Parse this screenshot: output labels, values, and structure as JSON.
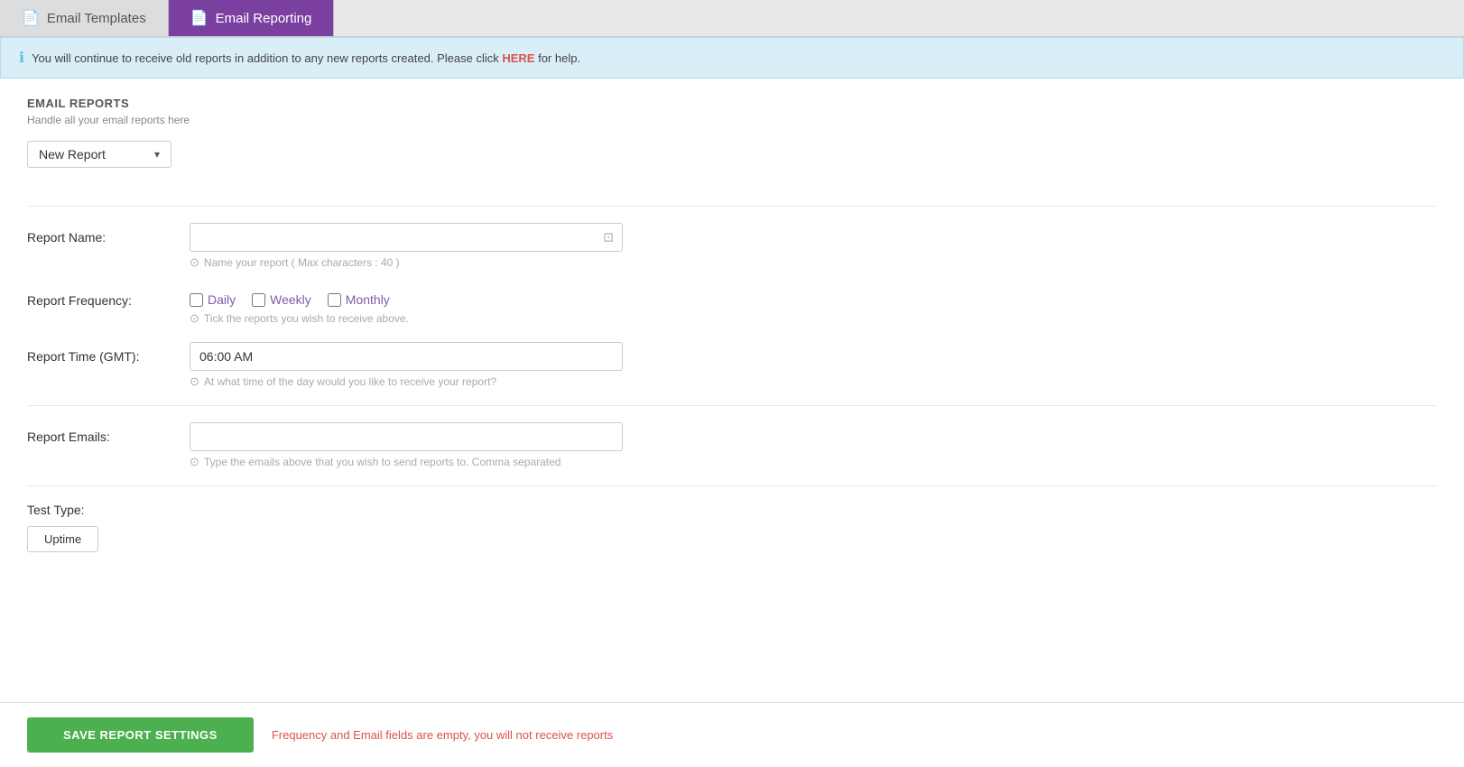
{
  "tabs": [
    {
      "id": "email-templates",
      "label": "Email Templates",
      "icon": "📄",
      "active": false
    },
    {
      "id": "email-reporting",
      "label": "Email Reporting",
      "icon": "📄",
      "active": true
    }
  ],
  "banner": {
    "icon": "ℹ",
    "text": "You will continue to receive old reports in addition to any new reports created. Please click ",
    "link_text": "HERE",
    "text_after": " for help."
  },
  "section": {
    "title": "EMAIL REPORTS",
    "subtitle": "Handle all your email reports here"
  },
  "report_select": {
    "label": "New Report",
    "chevron": "▾"
  },
  "form": {
    "report_name_label": "Report Name:",
    "report_name_hint": "Name your report ( Max characters : 40 )",
    "report_name_placeholder": "",
    "report_frequency_label": "Report Frequency:",
    "frequency_options": [
      {
        "id": "daily",
        "label": "Daily",
        "checked": false
      },
      {
        "id": "weekly",
        "label": "Weekly",
        "checked": false
      },
      {
        "id": "monthly",
        "label": "Monthly",
        "checked": false
      }
    ],
    "frequency_hint": "Tick the reports you wish to receive above.",
    "report_time_label": "Report Time (GMT):",
    "report_time_value": "06:00 AM",
    "report_time_hint": "At what time of the day would you like to receive your report?",
    "report_emails_label": "Report Emails:",
    "report_emails_placeholder": "",
    "report_emails_hint": "Type the emails above that you wish to send reports to. Comma separated",
    "test_type_label": "Test Type:",
    "test_type_button": "Uptime"
  },
  "footer": {
    "save_button_label": "SAVE REPORT SETTINGS",
    "warning_text": "Frequency and Email fields are empty, you will not receive reports"
  }
}
